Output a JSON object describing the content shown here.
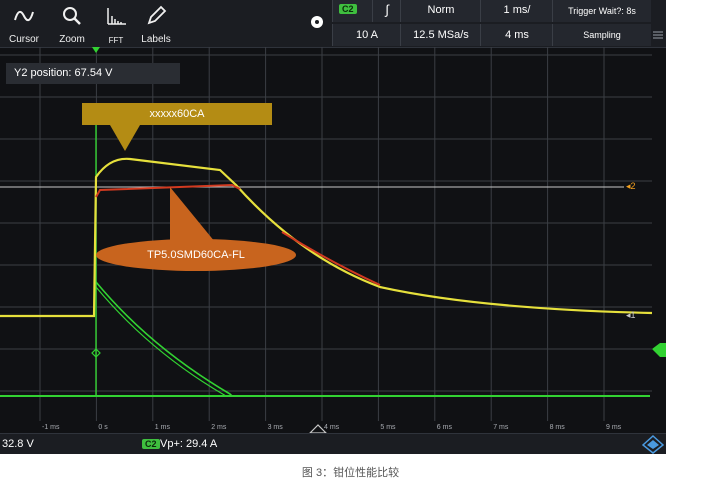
{
  "toolbar": {
    "buttons": [
      {
        "label": "Cursor",
        "icon": "waveform-cursor-icon"
      },
      {
        "label": "Zoom",
        "icon": "magnifier-icon"
      },
      {
        "label": "FFT",
        "icon": "fft-icon"
      },
      {
        "label": "Labels",
        "icon": "pencil-icon"
      }
    ],
    "channel_badge": "C2",
    "trigger_slope_symbol": "∫",
    "trigger_mode": "Norm",
    "time_per_div": "1 ms/",
    "trigger_status": "Trigger Wait?: 8s",
    "current_range": "10 A",
    "sample_rate": "12.5 MSa/s",
    "record_length": "4 ms",
    "acq_mode": "Sampling"
  },
  "overlay": {
    "y2_position": "Y2 position: 67.54 V",
    "callout_upper": "xxxxx60CA",
    "callout_lower": "TP5.0SMD60CA-FL"
  },
  "markers": {
    "ref_2": "2",
    "ref_1": "1"
  },
  "x_axis_ticks": [
    "-1 ms",
    "0 s",
    "1 ms",
    "2 ms",
    "3 ms",
    "4 ms",
    "5 ms",
    "6 ms",
    "7 ms",
    "8 ms",
    "9 ms"
  ],
  "bottom_bar": {
    "left_readout": "32.8 V",
    "channel_badge": "C2",
    "measurement": "Vp+: 29.4 A"
  },
  "caption": "图 3：钳位性能比较",
  "colors": {
    "trace_yellow": "#e6e03c",
    "trace_red": "#d23a20",
    "trace_green": "#32d232",
    "callout_upper": "#b48c14",
    "callout_lower": "#c8641e",
    "background": "#101114"
  }
}
